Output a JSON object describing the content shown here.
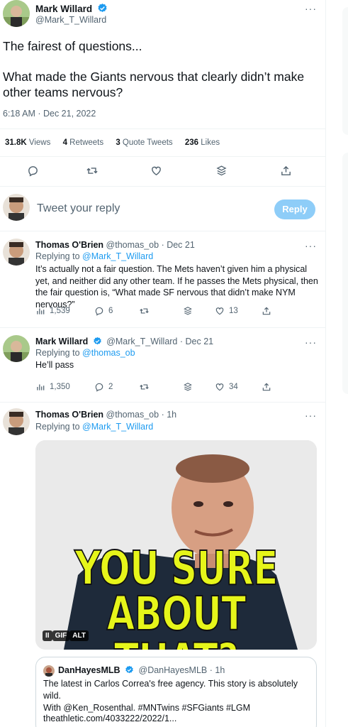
{
  "main_tweet": {
    "author_name": "Mark Willard",
    "author_handle": "@Mark_T_Willard",
    "text_line1": "The fairest of questions...",
    "text_line2": "What made the Giants nervous that clearly didn’t make other teams nervous?",
    "timestamp": "6:18 AM · Dec 21, 2022",
    "stats": {
      "views_count": "31.8K",
      "views_label": "Views",
      "retweets_count": "4",
      "retweets_label": "Retweets",
      "quotes_count": "3",
      "quotes_label": "Quote Tweets",
      "likes_count": "236",
      "likes_label": "Likes"
    }
  },
  "composer": {
    "placeholder": "Tweet your reply",
    "reply_label": "Reply"
  },
  "replies": [
    {
      "author_name": "Thomas O'Brien",
      "author_handle": "@thomas_ob",
      "time": "· Dec 21",
      "replying_prefix": "Replying to",
      "replying_to": "@Mark_T_Willard",
      "text": "It’s actually not a fair question. The Mets haven’t given him a physical yet, and neither did any other team. If he passes the Mets physical, then the fair question is, “What made SF nervous that didn’t make NYM nervous?”",
      "views": "1,539",
      "replies": "6",
      "likes": "13"
    },
    {
      "author_name": "Mark Willard",
      "author_handle": "@Mark_T_Willard",
      "time": "· Dec 21",
      "replying_prefix": "Replying to",
      "replying_to": "@thomas_ob",
      "text": "He’ll pass",
      "views": "1,350",
      "replies": "2",
      "likes": "34"
    },
    {
      "author_name": "Thomas O'Brien",
      "author_handle": "@thomas_ob",
      "time": "· 1h",
      "replying_prefix": "Replying to",
      "replying_to": "@Mark_T_Willard",
      "gif_caption_line1": "YOU SURE",
      "gif_caption_line2": "ABOUT THAT?",
      "gif_pause": "II",
      "gif_label": "GIF",
      "gif_alt": "ALT"
    }
  ],
  "quote_tweet": {
    "author_name": "DanHayesMLB",
    "author_handle": "@DanHayesMLB",
    "time": "· 1h",
    "text_line1": "The latest in Carlos Correa's free agency. This story is absolutely wild.",
    "text_line2_prefix": "With",
    "text_line2_mention": "@Ken_Rosenthal.",
    "text_line2_tags": "#MNTwins #SFGiants #LGM",
    "link": "theathletic.com/4033222/2022/1..."
  },
  "more_glyph": "···",
  "colors": {
    "accent": "#1d9bf0",
    "verified": "#1d9bf0",
    "reply_disabled": "#8ecdf8",
    "gif_text": "#e6f51a"
  }
}
